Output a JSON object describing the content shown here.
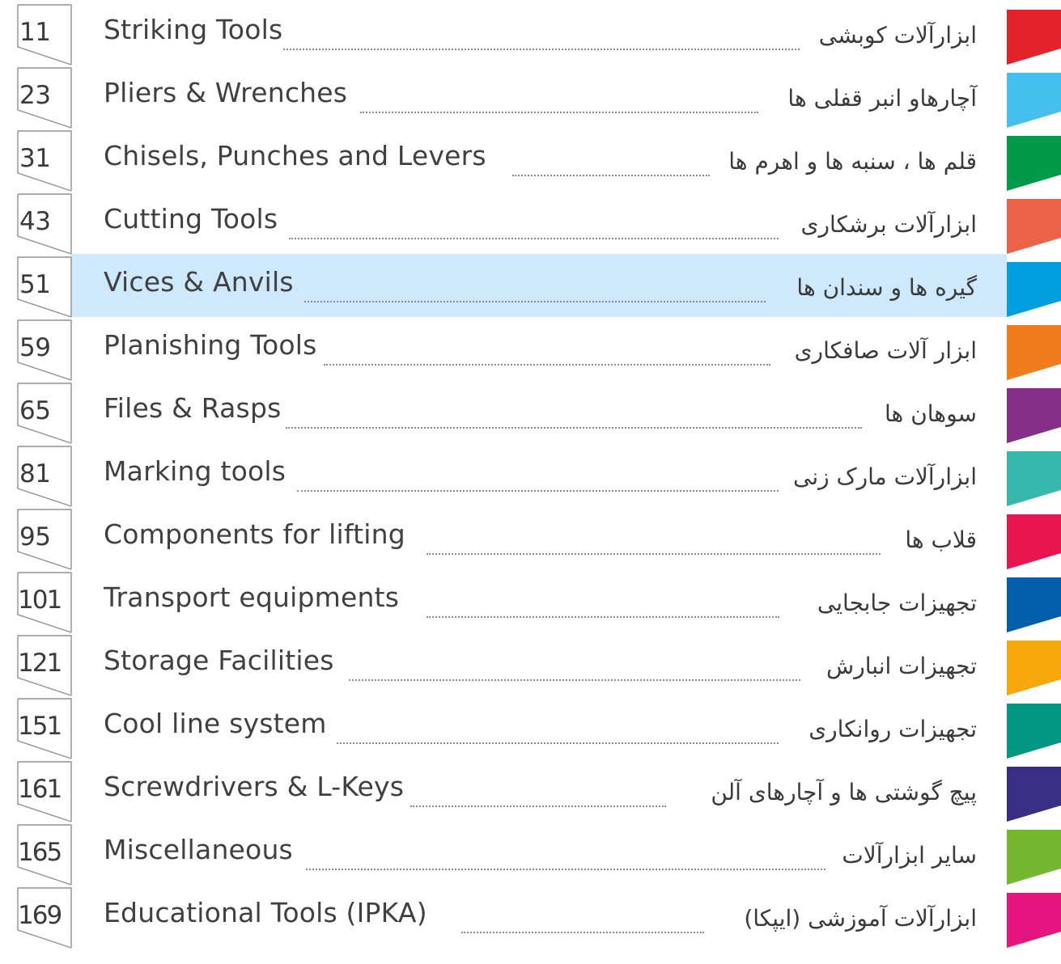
{
  "entries": [
    {
      "page": "11",
      "english": "Striking Tools",
      "persian": "ابزارآلات کوبشی",
      "color": "#e3232a"
    },
    {
      "page": "23",
      "english": "Pliers & Wrenches",
      "persian": "آچارهاو انبر قفلی ها",
      "color": "#44bfee"
    },
    {
      "page": "31",
      "english": "Chisels, Punches and Levers",
      "persian": "قلم ها ، سنبه ها و اهرم ها",
      "color": "#009a49"
    },
    {
      "page": "43",
      "english": "Cutting Tools",
      "persian": "ابزارآلات برشکاری",
      "color": "#ec6249"
    },
    {
      "page": "51",
      "english": "Vices & Anvils",
      "persian": "گیره ها و سندان ها",
      "color": "#019fe0",
      "highlighted": true
    },
    {
      "page": "59",
      "english": "Planishing Tools",
      "persian": "ابزار آلات صافکاری",
      "color": "#ef7d1c"
    },
    {
      "page": "65",
      "english": "Files & Rasps",
      "persian": "سوهان ها",
      "color": "#842e88"
    },
    {
      "page": "81",
      "english": "Marking tools",
      "persian": "ابزارآلات مارک زنی",
      "color": "#37b8ad"
    },
    {
      "page": "95",
      "english": "Components for lifting",
      "persian": "قلاب ها",
      "color": "#e8154f"
    },
    {
      "page": "101",
      "english": "Transport equipments",
      "persian": "تجهیزات جابجایی",
      "color": "#015eab"
    },
    {
      "page": "121",
      "english": "Storage Facilities",
      "persian": "تجهیزات انبارش",
      "color": "#f5a70c"
    },
    {
      "page": "151",
      "english": "Cool line system",
      "persian": "تجهیزات روانکاری",
      "color": "#019782"
    },
    {
      "page": "161",
      "english": "Screwdrivers & L-Keys",
      "persian": "پیچ گوشتی ها و آچارهای آلن",
      "color": "#382f84"
    },
    {
      "page": "165",
      "english": "Miscellaneous",
      "persian": "سایر ابزارآلات",
      "color": "#75b82f"
    },
    {
      "page": "169",
      "english": "Educational Tools (IPKA)",
      "persian": "ابزارآلات آموزشی (ایپکا)",
      "color": "#e4157f"
    }
  ],
  "highlight_color": "#cde9fb"
}
